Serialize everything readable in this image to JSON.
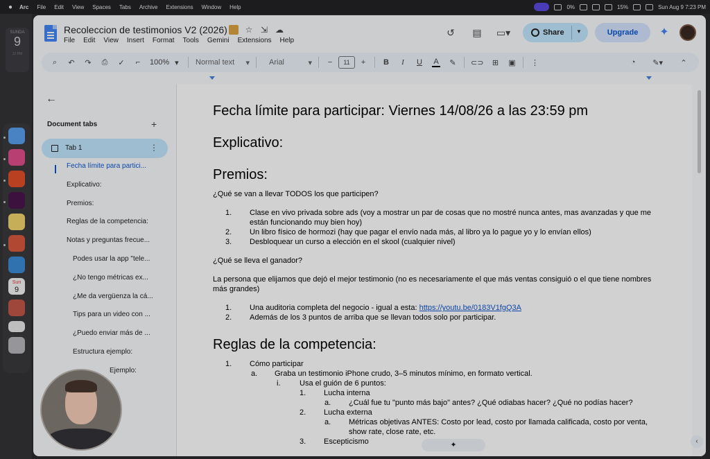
{
  "menubar": {
    "app_name": "Arc",
    "items": [
      "File",
      "Edit",
      "View",
      "Spaces",
      "Tabs",
      "Archive",
      "Extensions",
      "Window",
      "Help"
    ],
    "battery_percent": "15%",
    "cpu_percent": "0%",
    "datetime": "Sun Aug 9  7:23 PM"
  },
  "widget": {
    "day": "SUNDA",
    "date": "9",
    "time": "12 PM"
  },
  "dock": {
    "icons": [
      "finder-icon",
      "arc-icon",
      "brave-icon",
      "slack-icon",
      "notes-icon",
      "flower-app-icon",
      "freeform-icon",
      "calendar-icon",
      "photo-app-icon",
      "window-icon",
      "trash-icon"
    ],
    "calendar_day": "Sun",
    "calendar_date": "9"
  },
  "docs": {
    "title": "Recoleccion de testimonios V2 (2026)",
    "menu": [
      "File",
      "Edit",
      "View",
      "Insert",
      "Format",
      "Tools",
      "Gemini",
      "Extensions",
      "Help"
    ],
    "share_label": "Share",
    "upgrade_label": "Upgrade",
    "toolbar": {
      "zoom": "100%",
      "style": "Normal text",
      "font": "Arial",
      "font_size": "11",
      "bold": "B",
      "italic": "I",
      "underline": "U",
      "text_color": "A"
    }
  },
  "sidebar": {
    "heading": "Document tabs",
    "tab_label": "Tab 1",
    "outline": [
      {
        "label": "Fecha límite para partici...",
        "level": 1,
        "active": true
      },
      {
        "label": "Explicativo:",
        "level": 1
      },
      {
        "label": "Premios:",
        "level": 1
      },
      {
        "label": "Reglas de la competencia:",
        "level": 1
      },
      {
        "label": "Notas y preguntas frecue...",
        "level": 1
      },
      {
        "label": "Podes usar la app \"tele...",
        "level": 2
      },
      {
        "label": "¿No tengo métricas ex...",
        "level": 2
      },
      {
        "label": "¿Me da vergüenza la cá...",
        "level": 2
      },
      {
        "label": "Tips para un video con ...",
        "level": 2
      },
      {
        "label": "¿Puedo enviar más de ...",
        "level": 2
      },
      {
        "label": "Estructura ejemplo:",
        "level": 2
      },
      {
        "label": "Ejemplo:",
        "level": 2
      }
    ]
  },
  "doc": {
    "h_deadline": "Fecha límite para participar: Viernes 14/08/26 a las 23:59 pm",
    "h_explicativo": "Explicativo:",
    "h_premios": "Premios:",
    "q_todos": "¿Qué se van a llevar TODOS los que participen?",
    "premios_list": [
      {
        "num": "1.",
        "text": "Clase en vivo privada sobre ads (voy a mostrar un par de cosas que no mostré nunca antes, mas avanzadas y que me están funcionando muy bien hoy)"
      },
      {
        "num": "2.",
        "text": "Un libro físico de hormozi (hay que pagar el envío nada más, al libro ya lo pague yo y lo envían ellos)"
      },
      {
        "num": "3.",
        "text": "Desbloquear un curso a elección en el skool (cualquier nivel)"
      }
    ],
    "q_ganador": "¿Qué se lleva el ganador?",
    "p_ganador": "La persona que elijamos que dejó el mejor testimonio (no es necesariamente el que más ventas consiguió o el que tiene nombres más grandes)",
    "ganador_1_text": "Una auditoria completa del negocio - igual a esta: ",
    "ganador_1_link": "https://youtu.be/0183V1fgQ3A",
    "ganador_2_text": "Además de los 3 puntos de arriba que se llevan todos solo por participar.",
    "h_reglas": "Reglas de la competencia:",
    "reglas": {
      "r1": "Cómo participar",
      "r1a": "Graba un testimonio iPhone crudo, 3–5 minutos mínimo, en formato vertical.",
      "r1ai": "Usa el guión de 6 puntos:",
      "p1": "Lucha interna",
      "p1a": "¿Cuál fue tu \"punto más bajo\" antes? ¿Qué odiabas hacer? ¿Qué no podías hacer?",
      "p2": "Lucha externa",
      "p2a_1": "Métricas objetivas ANTES: Costo por lead, costo por llamada calificada, costo por venta,",
      "p2a_2": "show rate, close rate, etc.",
      "p3": "Escepticismo"
    },
    "gemini_glyph": "✦"
  }
}
